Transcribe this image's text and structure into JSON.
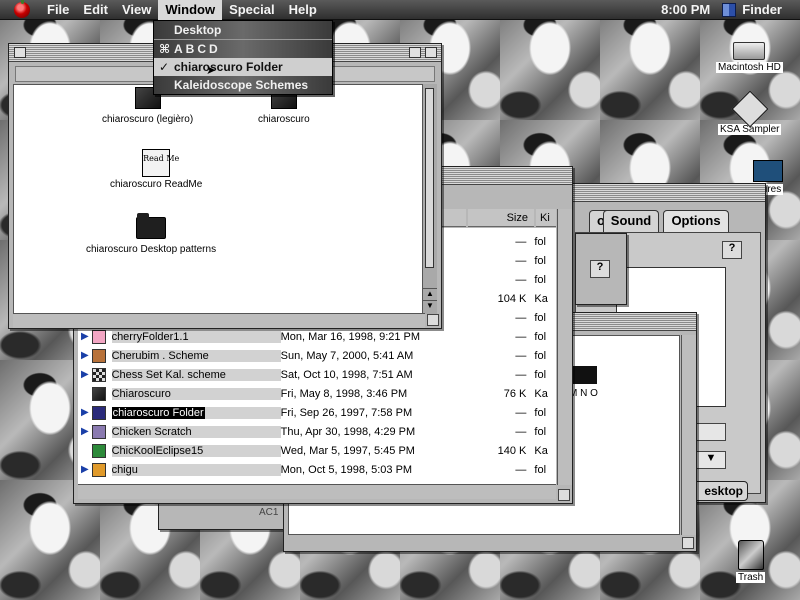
{
  "menubar": {
    "menus": [
      "File",
      "Edit",
      "View",
      "Window",
      "Special",
      "Help"
    ],
    "open_menu": "Window",
    "clock": "8:00 PM",
    "app_name": "Finder"
  },
  "window_menu": {
    "items": [
      {
        "label": "Desktop",
        "checked": false,
        "selected": false
      },
      {
        "label": "ABCD",
        "checked": false,
        "selected": false
      },
      {
        "label": "chiaroscuro Folder",
        "checked": true,
        "selected": true
      },
      {
        "label": "Kaleidoscope Schemes",
        "checked": false,
        "selected": false
      }
    ]
  },
  "front_window": {
    "icons": [
      {
        "label": "chiaroscuro (legièro)",
        "icon": "dark-application-icon"
      },
      {
        "label": "chiaroscuro",
        "icon": "dark-application-icon"
      },
      {
        "label": "chiaroscuro ReadMe",
        "icon": "readme-document-icon",
        "icon_text": "Read Me"
      },
      {
        "label": "chiaroscuro Desktop patterns",
        "icon": "folder-icon"
      }
    ]
  },
  "list_window": {
    "columns": {
      "size": "Size",
      "kind": "Ki"
    },
    "rows": [
      {
        "name": "",
        "date": "",
        "size": "—",
        "kind": "fol"
      },
      {
        "name": "",
        "date": "",
        "size": "—",
        "kind": "fol"
      },
      {
        "name": "",
        "date": "",
        "size": "—",
        "kind": "fol"
      },
      {
        "name": "",
        "date": "",
        "size": "104 K",
        "kind": "Ka"
      },
      {
        "name": "",
        "date": "",
        "size": "—",
        "kind": "fol"
      },
      {
        "name": "cherryFolder1.1",
        "date": "Mon, Mar 16, 1998, 9:21 PM",
        "size": "—",
        "kind": "fol"
      },
      {
        "name": "Cherubim . Scheme",
        "date": "Sun, May 7, 2000, 5:41 AM",
        "size": "—",
        "kind": "fol"
      },
      {
        "name": "Chess Set Kal. scheme",
        "date": "Sat, Oct 10, 1998, 7:51 AM",
        "size": "—",
        "kind": "fol"
      },
      {
        "name": "Chiaroscuro",
        "date": "Fri, May 8, 1998, 3:46 PM",
        "size": "76 K",
        "kind": "Ka"
      },
      {
        "name": "chiaroscuro Folder",
        "date": "Fri, Sep 26, 1997, 7:58 PM",
        "size": "—",
        "kind": "fol",
        "highlight": true
      },
      {
        "name": "Chicken Scratch",
        "date": "Thu, Apr 30, 1998, 4:29 PM",
        "size": "—",
        "kind": "fol"
      },
      {
        "name": "ChicKoolEclipse15",
        "date": "Wed, Mar 5, 1997, 5:45 PM",
        "size": "140 K",
        "kind": "Ka"
      },
      {
        "name": "chigu",
        "date": "Mon, Oct 5, 1998, 5:03 PM",
        "size": "—",
        "kind": "fol"
      }
    ]
  },
  "prefs_window": {
    "tabs": [
      "op",
      "Sound",
      "Options"
    ],
    "button_label": "esktop",
    "help_icon": "?"
  },
  "dialog_window": {
    "help_icon": "?"
  },
  "bottom_window": {
    "text": "M N O"
  },
  "behind_label": "AC1",
  "desktop": {
    "icons": [
      {
        "label": "Macintosh HD",
        "icon": "hard-disk-icon"
      },
      {
        "label": "KSA Sampler",
        "icon": "ksa-sampler-icon"
      },
      {
        "label": "xtures",
        "icon": "textures-folder-icon"
      },
      {
        "label": "Trash",
        "icon": "trash-icon"
      }
    ]
  }
}
